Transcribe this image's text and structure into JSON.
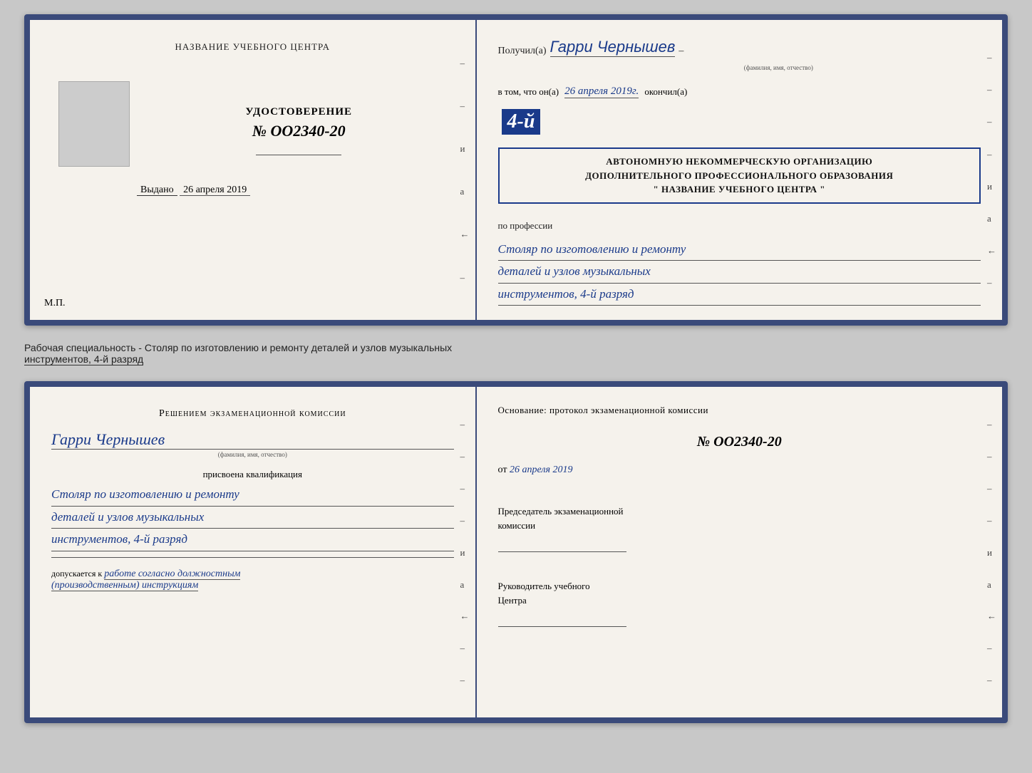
{
  "top_doc": {
    "left": {
      "center_title": "НАЗВАНИЕ УЧЕБНОГО ЦЕНТРА",
      "photo_alt": "photo",
      "udost_label": "УДОСТОВЕРЕНИЕ",
      "udost_number": "№ OO2340-20",
      "issued_label": "Выдано",
      "issued_date": "26 апреля 2019",
      "mp_label": "М.П."
    },
    "right": {
      "poluchil_label": "Получил(а)",
      "recipient_name": "Гарри Чернышев",
      "fio_caption": "(фамилия, имя, отчество)",
      "dash": "–",
      "vtom_label": "в том, что он(а)",
      "date_value": "26 апреля 2019г.",
      "okonchil_label": "окончил(а)",
      "year_badge": "4-й",
      "org_line1": "АВТОНОМНУЮ НЕКОММЕРЧЕСКУЮ ОРГАНИЗАЦИЮ",
      "org_line2": "ДОПОЛНИТЕЛЬНОГО ПРОФЕССИОНАЛЬНОГО ОБРАЗОВАНИЯ",
      "org_name": "\" НАЗВАНИЕ УЧЕБНОГО ЦЕНТРА \"",
      "profession_label": "по профессии",
      "profession_line1": "Столяр по изготовлению и ремонту",
      "profession_line2": "деталей и узлов музыкальных",
      "profession_line3": "инструментов, 4-й разряд"
    }
  },
  "caption": {
    "text_prefix": "Рабочая специальность - Столяр по изготовлению и ремонту деталей и узлов музыкальных",
    "text_underline": "инструментов, 4-й разряд"
  },
  "bottom_doc": {
    "left": {
      "commission_title": "Решением  экзаменационной  комиссии",
      "name_value": "Гарри Чернышев",
      "fio_caption": "(фамилия, имя, отчество)",
      "prisvoena_label": "присвоена квалификация",
      "qual_line1": "Столяр по изготовлению и ремонту",
      "qual_line2": "деталей и узлов музыкальных",
      "qual_line3": "инструментов, 4-й разряд",
      "dopusk_prefix": "допускается к",
      "dopusk_hw": "работе согласно должностным",
      "dopusk_hw2": "(производственным) инструкциям"
    },
    "right": {
      "osnov_label": "Основание: протокол  экзаменационной  комиссии",
      "protocol_number": "№  OO2340-20",
      "from_label": "от",
      "from_date": "26 апреля 2019",
      "chairman_line1": "Председатель экзаменационной",
      "chairman_line2": "комиссии",
      "rukov_line1": "Руководитель учебного",
      "rukov_line2": "Центра"
    }
  },
  "side_chars": {
    "и": "и",
    "а": "а",
    "langle": "←"
  }
}
